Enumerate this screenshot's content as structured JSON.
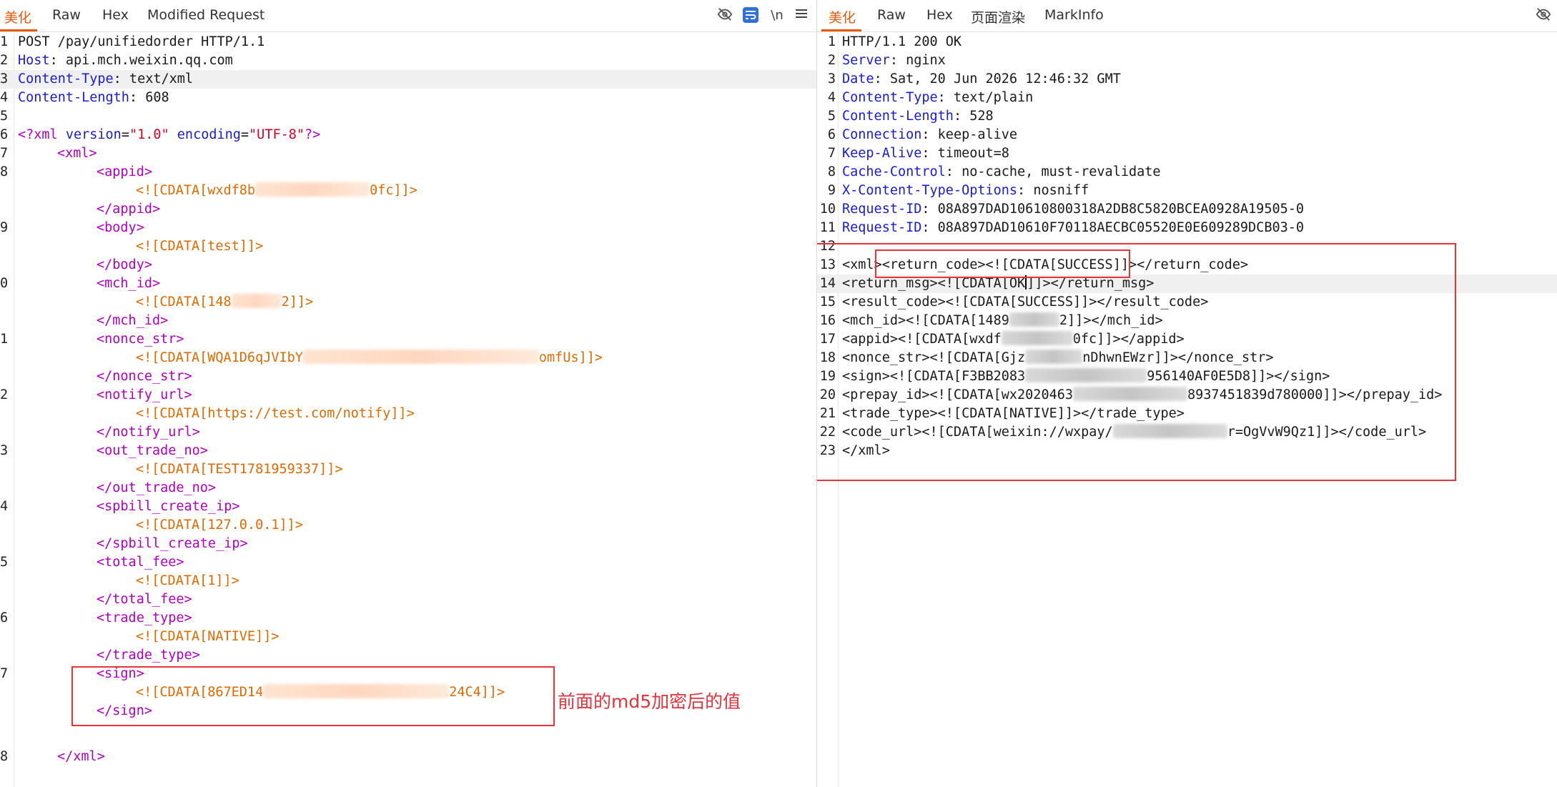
{
  "request_pane": {
    "tabs": [
      "美化",
      "Raw",
      "Hex",
      "Modified Request"
    ],
    "active_tab": "美化",
    "toolbar_icons": [
      "eye-off-icon",
      "wrap-lines-icon",
      "newline-toggle-icon",
      "menu-icon"
    ],
    "newline_label": "\\n",
    "http_lines": [
      {
        "num": "1",
        "text": "POST /pay/unifiedorder HTTP/1.1"
      },
      {
        "num": "2",
        "key": "Host",
        "value": " api.mch.weixin.qq.com"
      },
      {
        "num": "3",
        "key": "Content-Type",
        "value": " text/xml"
      },
      {
        "num": "4",
        "key": "Content-Length",
        "value": " 608"
      },
      {
        "num": "5",
        "text": ""
      }
    ],
    "xml_declaration": {
      "num": "6",
      "open": "<?xml",
      "attr1_name": "version",
      "attr1_value": "\"1.0\"",
      "attr2_name": "encoding",
      "attr2_value": "\"UTF-8\"",
      "close": "?>"
    },
    "root_open": {
      "num": "7",
      "text": "<xml>"
    },
    "fields": [
      {
        "num": "8",
        "open": "<appid>",
        "cdata_start": "<![CDATA[wxdf8b",
        "cdata_end": "0fc]]>",
        "close": "</appid>"
      },
      {
        "num": "9",
        "open": "<body>",
        "cdata_start": "<![CDATA[test]]>",
        "cdata_end": "",
        "close": "</body>"
      },
      {
        "num": "0",
        "open": "<mch_id>",
        "cdata_start": "<![CDATA[148",
        "cdata_end": "2]]>",
        "close": "</mch_id>"
      },
      {
        "num": "1",
        "open": "<nonce_str>",
        "cdata_start": "<![CDATA[WQA1D6qJVIbY",
        "cdata_end": "omfUs]]>",
        "close": "</nonce_str>"
      },
      {
        "num": "2",
        "open": "<notify_url>",
        "cdata_start": "<![CDATA[https://test.com/notify]]>",
        "cdata_end": "",
        "close": "</notify_url>"
      },
      {
        "num": "3",
        "open": "<out_trade_no>",
        "cdata_start": "<![CDATA[TEST1781959337]]>",
        "cdata_end": "",
        "close": "</out_trade_no>"
      },
      {
        "num": "4",
        "open": "<spbill_create_ip>",
        "cdata_start": "<![CDATA[127.0.0.1]]>",
        "cdata_end": "",
        "close": "</spbill_create_ip>"
      },
      {
        "num": "5",
        "open": "<total_fee>",
        "cdata_start": "<![CDATA[1]]>",
        "cdata_end": "",
        "close": "</total_fee>"
      },
      {
        "num": "6",
        "open": "<trade_type>",
        "cdata_start": "<![CDATA[NATIVE]]>",
        "cdata_end": "",
        "close": "</trade_type>"
      },
      {
        "num": "7",
        "open": "<sign>",
        "cdata_start": "<![CDATA[867ED14",
        "cdata_end": "24C4]]>",
        "close": "</sign>"
      }
    ],
    "root_close": {
      "num": "8",
      "text": "</xml>"
    },
    "annotation": "前面的md5加密后的值"
  },
  "response_pane": {
    "tabs": [
      "美化",
      "Raw",
      "Hex",
      "页面渲染",
      "MarkInfo"
    ],
    "active_tab": "美化",
    "toolbar_icons": [
      "eye-off-icon"
    ],
    "headers": [
      {
        "num": "1",
        "text": "HTTP/1.1 200 OK"
      },
      {
        "num": "2",
        "key": "Server",
        "value": " nginx"
      },
      {
        "num": "3",
        "key": "Date",
        "value": " Sat, 20 Jun 2026 12:46:32 GMT"
      },
      {
        "num": "4",
        "key": "Content-Type",
        "value": " text/plain"
      },
      {
        "num": "5",
        "key": "Content-Length",
        "value": " 528"
      },
      {
        "num": "6",
        "key": "Connection",
        "value": " keep-alive"
      },
      {
        "num": "7",
        "key": "Keep-Alive",
        "value": " timeout=8"
      },
      {
        "num": "8",
        "key": "Cache-Control",
        "value": " no-cache, must-revalidate"
      },
      {
        "num": "9",
        "key": "X-Content-Type-Options",
        "value": " nosniff"
      },
      {
        "num": "10",
        "key": "Request-ID",
        "value": " 08A897DAD10610800318A2DB8C5820BCEA0928A19505-0"
      },
      {
        "num": "11",
        "key": "Request-ID",
        "value": " 08A897DAD10610F70118AECBC05520E0E609289DCB03-0"
      },
      {
        "num": "12",
        "text": ""
      }
    ],
    "body_lines": [
      {
        "num": "13",
        "start": "<xml><return_code><![CDATA[SUCCESS]]></return_code>",
        "end": ""
      },
      {
        "num": "14",
        "start": "<return_msg><![CDATA[OK",
        "end": "]]></return_msg>"
      },
      {
        "num": "15",
        "start": "<result_code><![CDATA[SUCCESS]]></result_code>",
        "end": ""
      },
      {
        "num": "16",
        "start": "<mch_id><![CDATA[1489",
        "end": "2]]></mch_id>"
      },
      {
        "num": "17",
        "start": "<appid><![CDATA[wxdf",
        "end": "0fc]]></appid>"
      },
      {
        "num": "18",
        "start": "<nonce_str><![CDATA[Gjz",
        "end": "nDhwnEWzr]]></nonce_str>"
      },
      {
        "num": "19",
        "start": "<sign><![CDATA[F3BB2083",
        "end": "956140AF0E5D8]]></sign>"
      },
      {
        "num": "20",
        "start": "<prepay_id><![CDATA[wx2020463",
        "end": "8937451839d780000]]></prepay_id>"
      },
      {
        "num": "21",
        "start": "<trade_type><![CDATA[NATIVE]]></trade_type>",
        "end": ""
      },
      {
        "num": "22",
        "start": "<code_url><![CDATA[weixin://wxpay/",
        "end": "r=OgVvW9Qz1]]></code_url>"
      },
      {
        "num": "23",
        "start": "</xml>",
        "end": ""
      }
    ]
  }
}
